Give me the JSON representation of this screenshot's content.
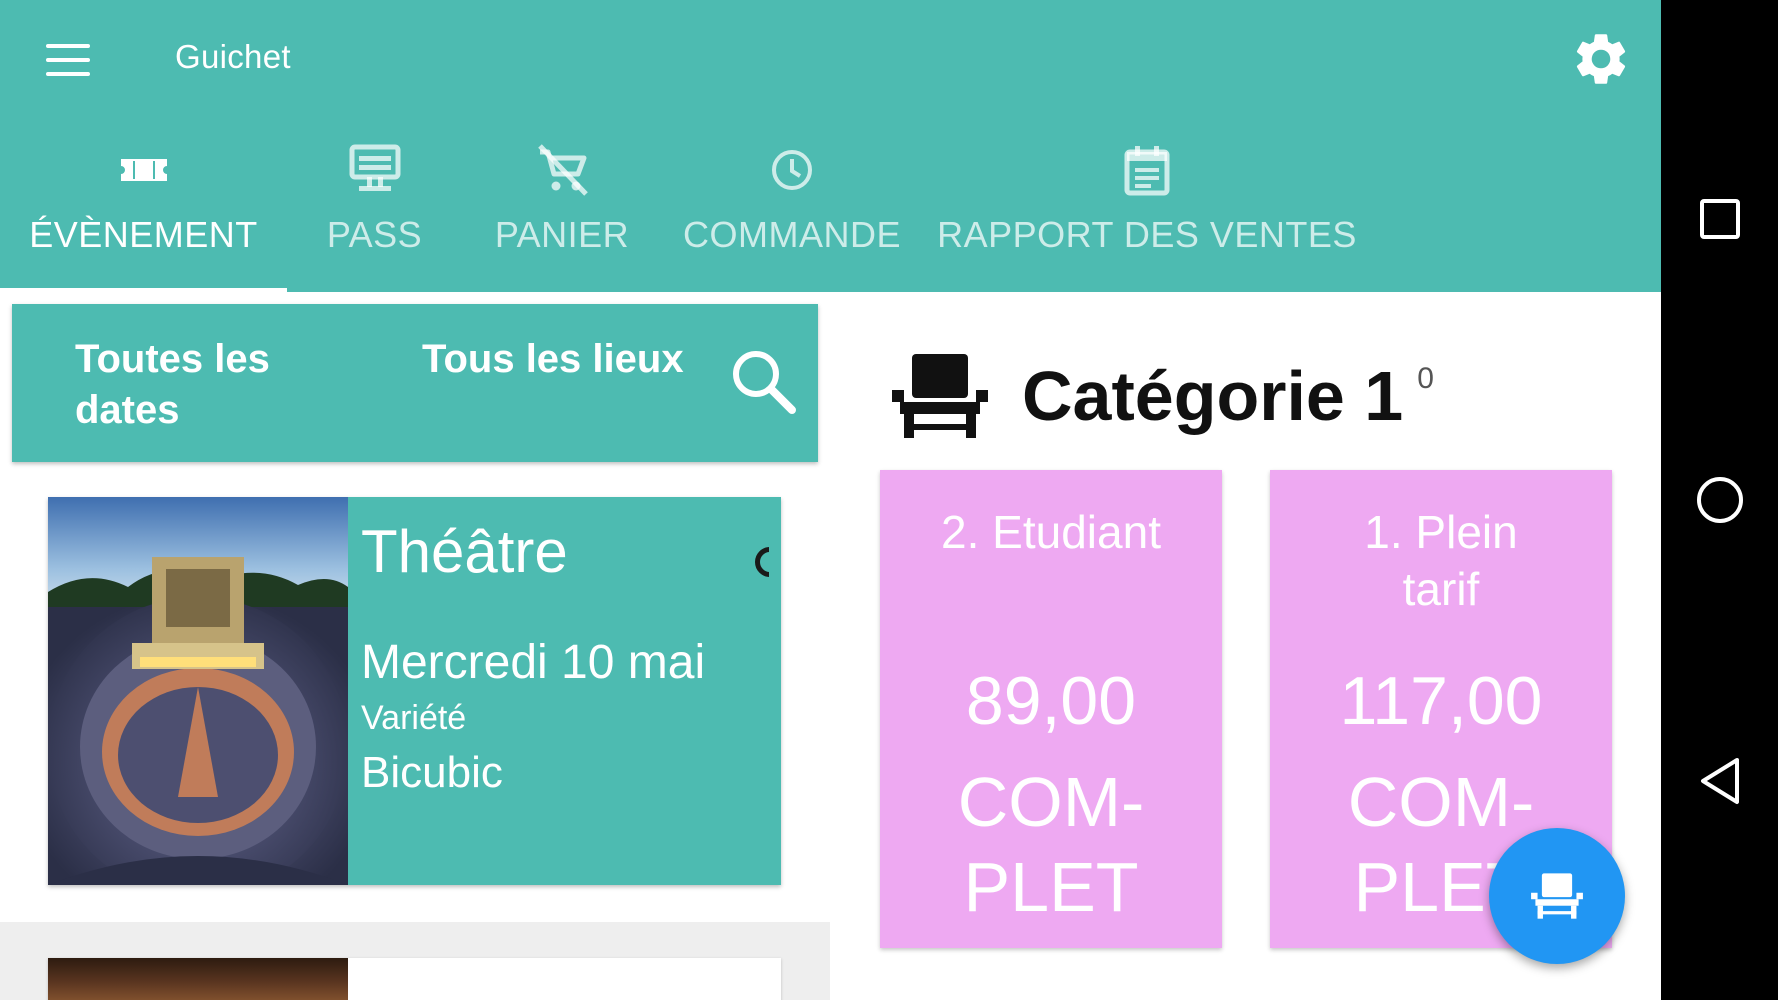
{
  "app": {
    "title": "Guichet",
    "colors": {
      "primary": "#4DBBB1",
      "tarif_card": "#EEA9F2",
      "fab": "#2196F3",
      "navbar": "#000000"
    }
  },
  "toolbar": {
    "menu_icon": "hamburger-menu-icon",
    "settings_icon": "gear-icon"
  },
  "tabs": [
    {
      "label": "ÉVÈNEMENT",
      "icon": "ticket-icon",
      "active": true
    },
    {
      "label": "PASS",
      "icon": "pass-card-icon",
      "active": false
    },
    {
      "label": "PANIER",
      "icon": "cart-off-icon",
      "active": false
    },
    {
      "label": "COMMANDE",
      "icon": "clock-icon",
      "active": false
    },
    {
      "label": "RAPPORT DES VENTES",
      "icon": "calendar-report-icon",
      "active": false
    }
  ],
  "filters": {
    "dates_label": "Toutes les dates",
    "lieux_label": "Tous les lieux",
    "search_icon": "search-icon"
  },
  "events": [
    {
      "title": "Théâtre",
      "date": "Mercredi 10 mai",
      "genre": "Variété",
      "venue": "Bicubic"
    }
  ],
  "category": {
    "icon": "seat-icon",
    "title": "Catégorie 1",
    "count": "0"
  },
  "tarifs": [
    {
      "name": "2. Etudiant",
      "price": "89,00",
      "status": "COM-PLET"
    },
    {
      "name": "1. Plein tarif",
      "price": "117,00",
      "status": "COM-PLET"
    }
  ],
  "fab": {
    "icon": "seat-icon"
  },
  "system_nav": {
    "recent_icon": "square-recent-apps-icon",
    "home_icon": "circle-home-icon",
    "back_icon": "triangle-back-icon"
  }
}
